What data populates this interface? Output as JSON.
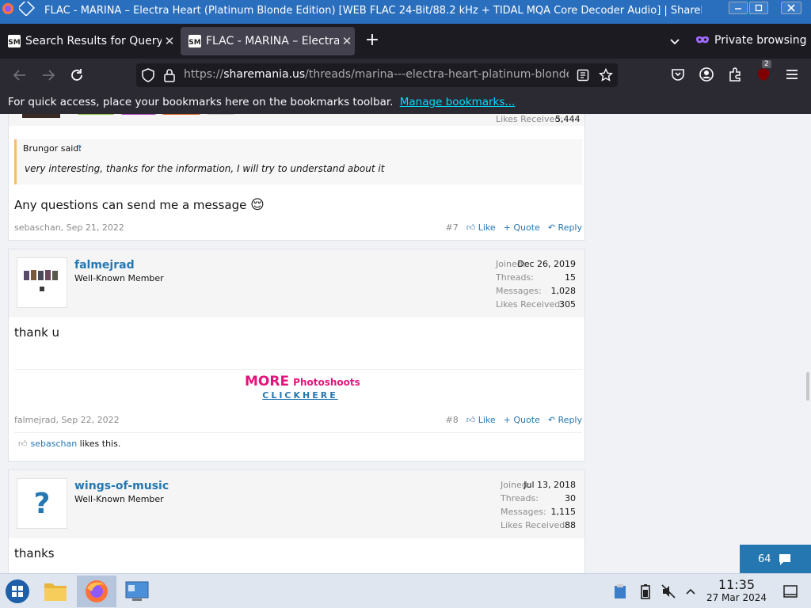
{
  "window": {
    "title": "FLAC - MARINA – Electra Heart (Platinum Blonde Edition) [WEB FLAC 24-Bit/88.2 kHz + TIDAL MQA Core Decoder Audio] | ShareMania.US — Mozilla Firefox"
  },
  "tabs": [
    {
      "label": "Search Results for Query",
      "favicon": "sharemania-favicon"
    },
    {
      "label": "FLAC - MARINA – Electra Heart (Platinum Blonde Edition)",
      "favicon": "sharemania-favicon"
    }
  ],
  "private_label": "Private browsing",
  "url": {
    "prefix": "https://",
    "domain": "sharemania.us",
    "path": "/threads/marina---electra-heart-platinum-blonde-edition-web-flac-24-bit-88-2-khz-tidal-mqa-core-decoder-audio"
  },
  "extension_badge": "2",
  "bookmarks_bar": {
    "text": "For quick access, place your bookmarks here on the bookmarks toolbar.",
    "link": "Manage bookmarks..."
  },
  "posts": [
    {
      "likes_label": "Likes Received:",
      "likes_value": "5,444",
      "quote_author": "Brungor said:",
      "quote_arrow": "↑",
      "quote_text": "very interesting, thanks for the information, I will try to understand about it",
      "message": "Any questions can send me a message",
      "emoji": "😌",
      "author_date": "sebaschan, Sep 21, 2022",
      "number": "#7",
      "like": "Like",
      "quote": "+ Quote",
      "reply": "Reply"
    },
    {
      "username": "falmejrad",
      "user_title": "Well-Known Member",
      "stats": [
        {
          "label": "Joined:",
          "value": "Dec 26, 2019"
        },
        {
          "label": "Threads:",
          "value": "15"
        },
        {
          "label": "Messages:",
          "value": "1,028"
        },
        {
          "label": "Likes Received:",
          "value": "305"
        }
      ],
      "message": "thank u",
      "banner_more": "MORE",
      "banner_photoshoots": "Photoshoots",
      "banner_click": "CLICKHERE",
      "author_date": "falmejrad, Sep 22, 2022",
      "number": "#8",
      "like": "Like",
      "quote": "+ Quote",
      "reply": "Reply",
      "liked_by": "sebaschan",
      "liked_suffix": " likes this."
    },
    {
      "username": "wings-of-music",
      "user_title": "Well-Known Member",
      "avatar_glyph": "?",
      "stats": [
        {
          "label": "Joined:",
          "value": "Jul 13, 2018"
        },
        {
          "label": "Threads:",
          "value": "30"
        },
        {
          "label": "Messages:",
          "value": "1,115"
        },
        {
          "label": "Likes Received:",
          "value": "88"
        }
      ],
      "message": "thanks"
    }
  ],
  "comment_counter": "64",
  "clock": {
    "time": "11:35",
    "date": "27 Mar 2024"
  },
  "colors": {
    "link": "#2577b1",
    "quote_border": "#f9bc6d",
    "banner_pink": "#e0157b",
    "firefox_dark": "#1c1b22"
  }
}
